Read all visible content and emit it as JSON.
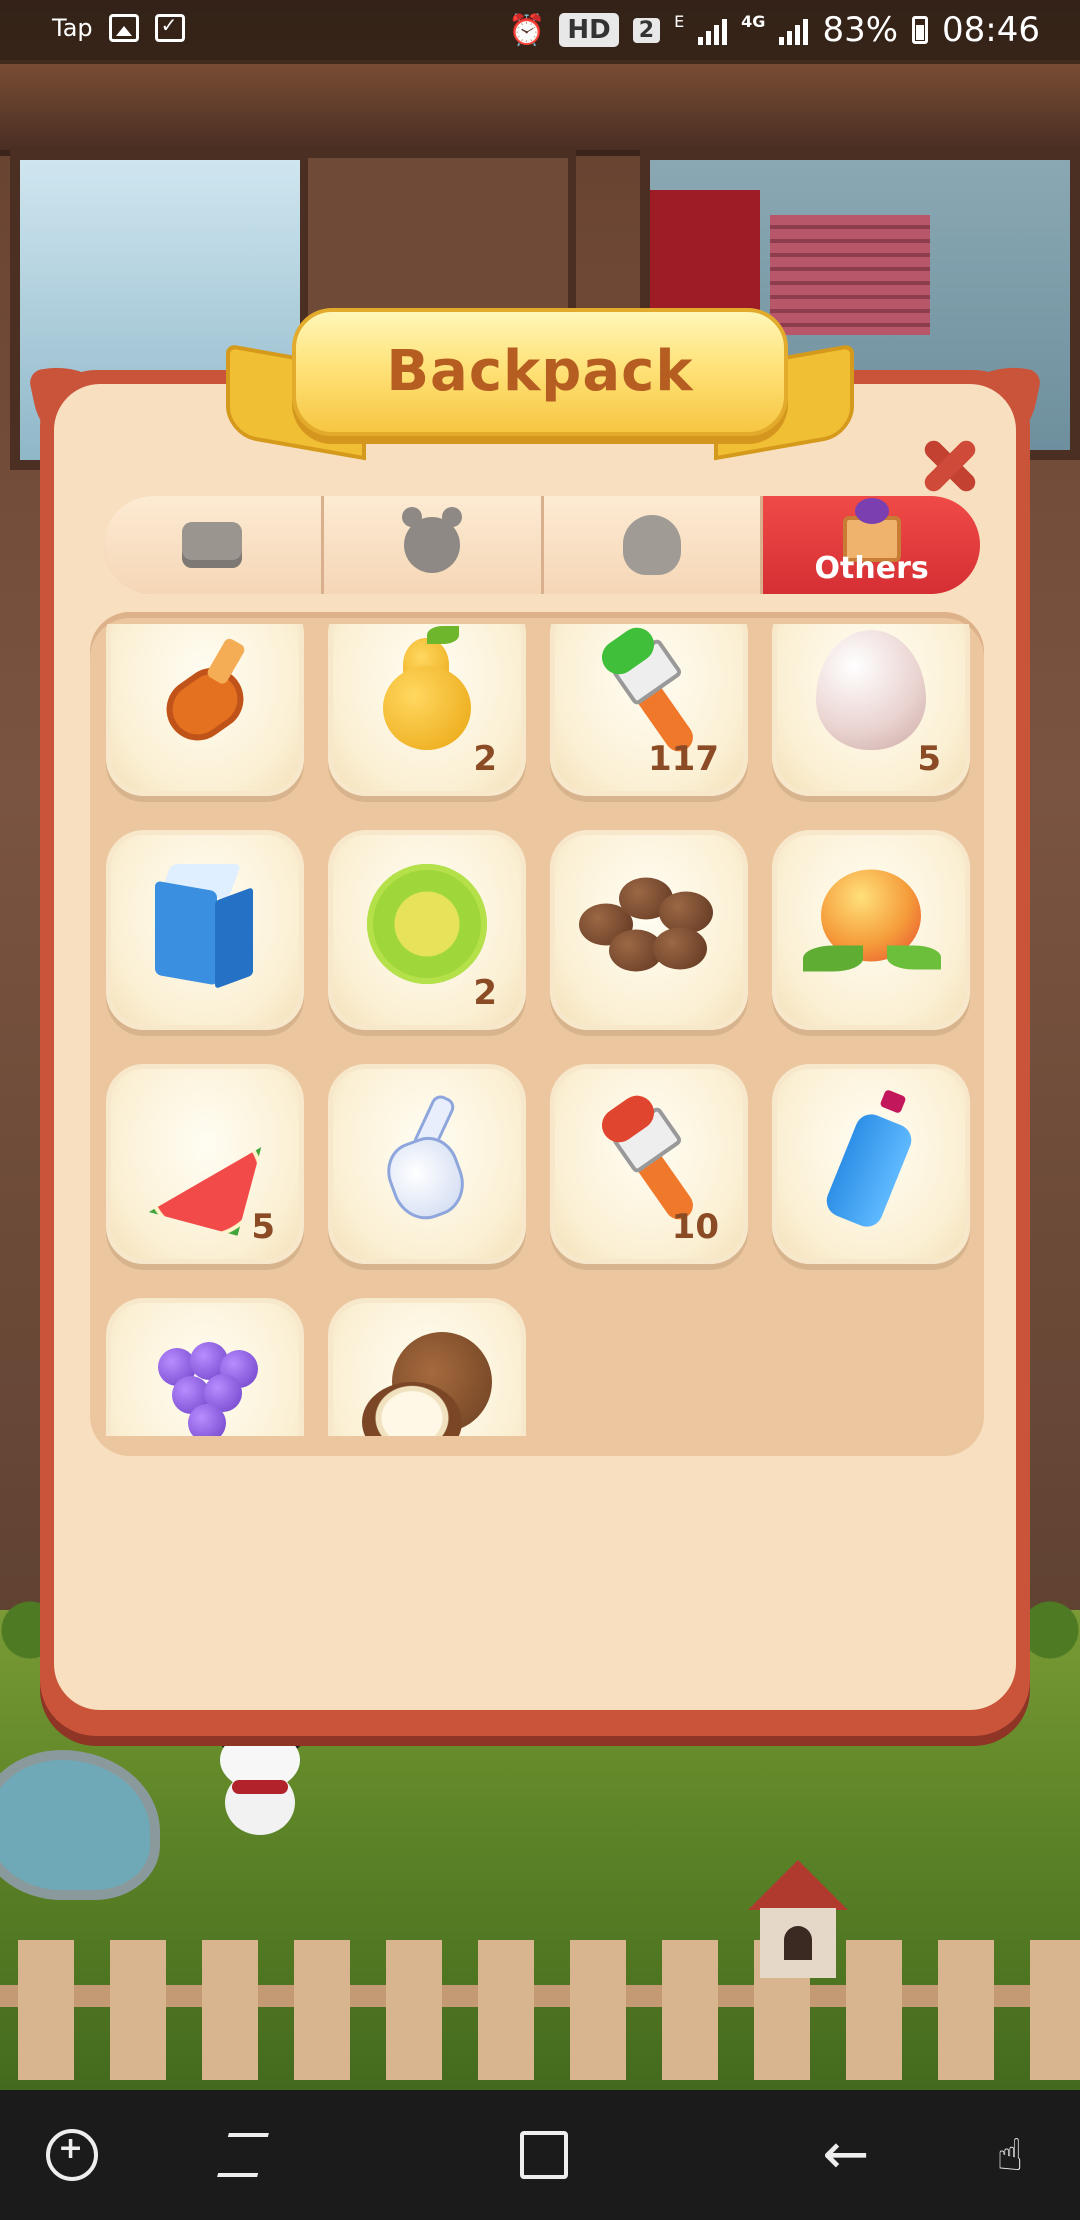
{
  "status_bar": {
    "left_text": "Tap",
    "hd_label": "HD",
    "sim_label": "2",
    "edge_label": "E",
    "network_label": "4G",
    "battery": "83%",
    "time": "08:46"
  },
  "modal": {
    "title": "Backpack",
    "tabs": [
      {
        "id": "tools",
        "icon": "tool-icon",
        "label": "",
        "active": false
      },
      {
        "id": "decor",
        "icon": "bear-icon",
        "label": "",
        "active": false
      },
      {
        "id": "bags",
        "icon": "bag-icon",
        "label": "",
        "active": false
      },
      {
        "id": "others",
        "icon": "crate-icon",
        "label": "Others",
        "active": true
      }
    ],
    "items": [
      {
        "name": "syrup-bottle",
        "icon": "bottle",
        "count": ""
      },
      {
        "name": "pear",
        "icon": "pear",
        "count": "2"
      },
      {
        "name": "green-paint-brush",
        "icon": "brush-green",
        "count": "117"
      },
      {
        "name": "egg",
        "icon": "egg",
        "count": "5"
      },
      {
        "name": "milk-carton",
        "icon": "milk",
        "count": ""
      },
      {
        "name": "durian",
        "icon": "durian",
        "count": "2"
      },
      {
        "name": "coffee-beans",
        "icon": "beans",
        "count": ""
      },
      {
        "name": "peach",
        "icon": "peach",
        "count": ""
      },
      {
        "name": "watermelon",
        "icon": "watermelon",
        "count": "5"
      },
      {
        "name": "porcelain-vase",
        "icon": "vase",
        "count": ""
      },
      {
        "name": "red-paint-brush",
        "icon": "brush-red",
        "count": "10"
      },
      {
        "name": "water-bottle",
        "icon": "water",
        "count": ""
      },
      {
        "name": "grapes",
        "icon": "grapes",
        "count": ""
      },
      {
        "name": "coconut",
        "icon": "coconut",
        "count": ""
      }
    ]
  },
  "colors": {
    "panel_border": "#c9543a",
    "panel_fill": "#f8dfbf",
    "active_tab": "#e23b3d",
    "title_text": "#b65d22",
    "count_text": "#8a4b25"
  },
  "nav_bar": {
    "buttons": [
      "game-tools-icon",
      "recent-apps-icon",
      "home-icon",
      "back-icon",
      "touch-gesture-icon"
    ]
  }
}
